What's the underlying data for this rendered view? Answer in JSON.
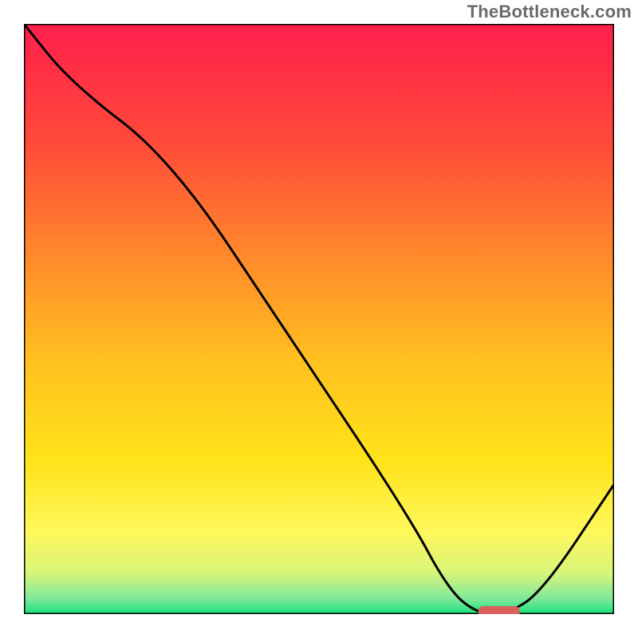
{
  "watermark": "TheBottleneck.com",
  "chart_data": {
    "type": "line",
    "title": "",
    "xlabel": "",
    "ylabel": "",
    "xlim": [
      0,
      100
    ],
    "ylim": [
      0,
      100
    ],
    "grid": false,
    "series": [
      {
        "name": "curve",
        "x": [
          0,
          8,
          25,
          45,
          65,
          72,
          77,
          82,
          88,
          100
        ],
        "y": [
          100,
          90,
          77,
          47,
          17,
          4,
          0,
          0,
          4,
          22
        ]
      }
    ],
    "marker": {
      "x_start": 77,
      "x_end": 84,
      "y": 0,
      "color": "#d9605a"
    },
    "gradient_stops": [
      {
        "offset": 0.0,
        "color": "#ff1f4b"
      },
      {
        "offset": 0.2,
        "color": "#ff4a3a"
      },
      {
        "offset": 0.4,
        "color": "#ff8b2a"
      },
      {
        "offset": 0.58,
        "color": "#ffc31f"
      },
      {
        "offset": 0.74,
        "color": "#ffe31a"
      },
      {
        "offset": 0.86,
        "color": "#fff85a"
      },
      {
        "offset": 0.93,
        "color": "#d8f57a"
      },
      {
        "offset": 0.975,
        "color": "#7de89a"
      },
      {
        "offset": 1.0,
        "color": "#17e07a"
      }
    ],
    "border_color": "#000000",
    "curve_color": "#000000"
  }
}
